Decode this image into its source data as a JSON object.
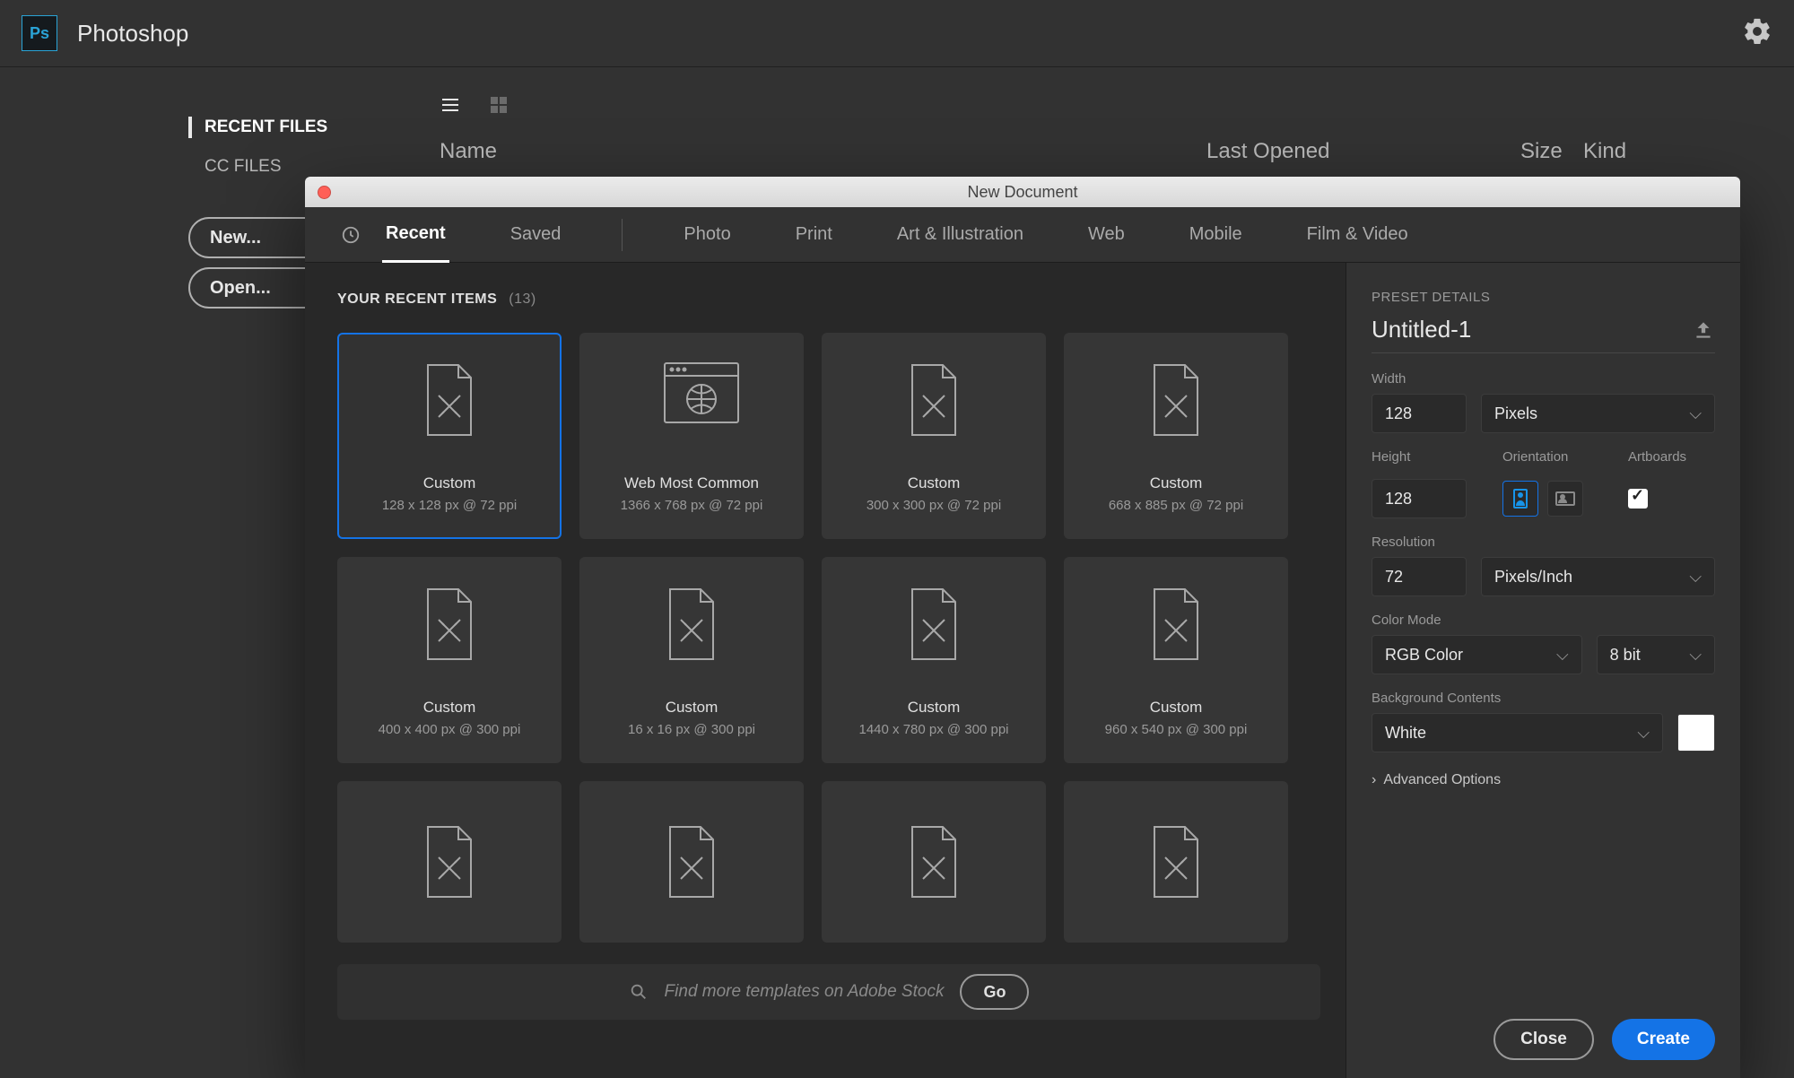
{
  "app": {
    "title": "Photoshop"
  },
  "start": {
    "sidebar": {
      "recent": "RECENT FILES",
      "cc": "CC FILES"
    },
    "buttons": {
      "new": "New...",
      "open": "Open..."
    },
    "columns": {
      "name": "Name",
      "last": "Last Opened",
      "size": "Size",
      "kind": "Kind"
    }
  },
  "dialog": {
    "title": "New Document",
    "tabs": [
      "Recent",
      "Saved",
      "Photo",
      "Print",
      "Art & Illustration",
      "Web",
      "Mobile",
      "Film & Video"
    ],
    "section": "YOUR RECENT ITEMS",
    "count": "(13)",
    "cards": [
      {
        "name": "Custom",
        "meta": "128 x 128 px @ 72 ppi",
        "selected": true,
        "icon": "doc"
      },
      {
        "name": "Web Most Common",
        "meta": "1366 x 768 px @ 72 ppi",
        "selected": false,
        "icon": "web"
      },
      {
        "name": "Custom",
        "meta": "300 x 300 px @ 72 ppi",
        "selected": false,
        "icon": "doc"
      },
      {
        "name": "Custom",
        "meta": "668 x 885 px @ 72 ppi",
        "selected": false,
        "icon": "doc"
      },
      {
        "name": "Custom",
        "meta": "400 x 400 px @ 300 ppi",
        "selected": false,
        "icon": "doc"
      },
      {
        "name": "Custom",
        "meta": "16 x 16 px @ 300 ppi",
        "selected": false,
        "icon": "doc"
      },
      {
        "name": "Custom",
        "meta": "1440 x 780 px @ 300 ppi",
        "selected": false,
        "icon": "doc"
      },
      {
        "name": "Custom",
        "meta": "960 x 540 px @ 300 ppi",
        "selected": false,
        "icon": "doc"
      },
      {
        "name": "",
        "meta": "",
        "selected": false,
        "icon": "doc",
        "short": true
      },
      {
        "name": "",
        "meta": "",
        "selected": false,
        "icon": "doc",
        "short": true
      },
      {
        "name": "",
        "meta": "",
        "selected": false,
        "icon": "doc",
        "short": true
      },
      {
        "name": "",
        "meta": "",
        "selected": false,
        "icon": "doc",
        "short": true
      }
    ],
    "search": {
      "placeholder": "Find more templates on Adobe Stock",
      "go": "Go"
    },
    "panel": {
      "head": "PRESET DETAILS",
      "name": "Untitled-1",
      "width_label": "Width",
      "width": "128",
      "width_unit": "Pixels",
      "height_label": "Height",
      "height": "128",
      "orient_label": "Orientation",
      "artboards_label": "Artboards",
      "res_label": "Resolution",
      "res": "72",
      "res_unit": "Pixels/Inch",
      "color_label": "Color Mode",
      "color_mode": "RGB Color",
      "bit_depth": "8 bit",
      "bg_label": "Background Contents",
      "bg": "White",
      "advanced": "Advanced Options",
      "close": "Close",
      "create": "Create"
    }
  }
}
